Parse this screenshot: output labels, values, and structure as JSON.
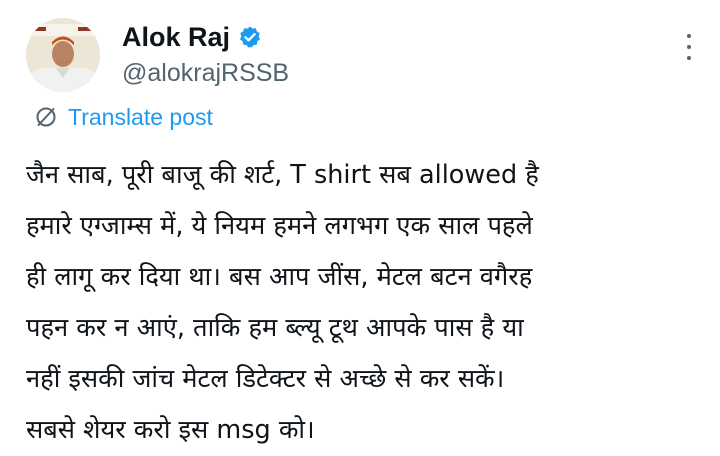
{
  "author": {
    "display_name": "Alok Raj",
    "handle": "@alokrajRSSB",
    "verified_icon": "verified-badge-icon",
    "verified_color": "#1d9bf0"
  },
  "actions": {
    "translate_label": "Translate post",
    "translate_icon": "globe-icon",
    "more_icon": "more-options-icon"
  },
  "post": {
    "lines": [
      "जैन साब, पूरी बाजू की शर्ट, T shirt सब allowed है",
      "हमारे एग्जाम्स में, ये नियम हमने लगभग एक साल पहले",
      "ही लागू कर दिया था। बस आप जींस,  मेटल बटन वगैरह",
      "पहन कर न आएं, ताकि हम ब्ल्यू टूथ आपके पास है या",
      "नहीं इसकी जांच मेटल डिटेक्टर से अच्छे से कर सकें।",
      "सबसे शेयर करो इस msg को।"
    ]
  },
  "colors": {
    "text": "#0f1419",
    "secondary": "#536471",
    "link": "#1d9bf0"
  }
}
